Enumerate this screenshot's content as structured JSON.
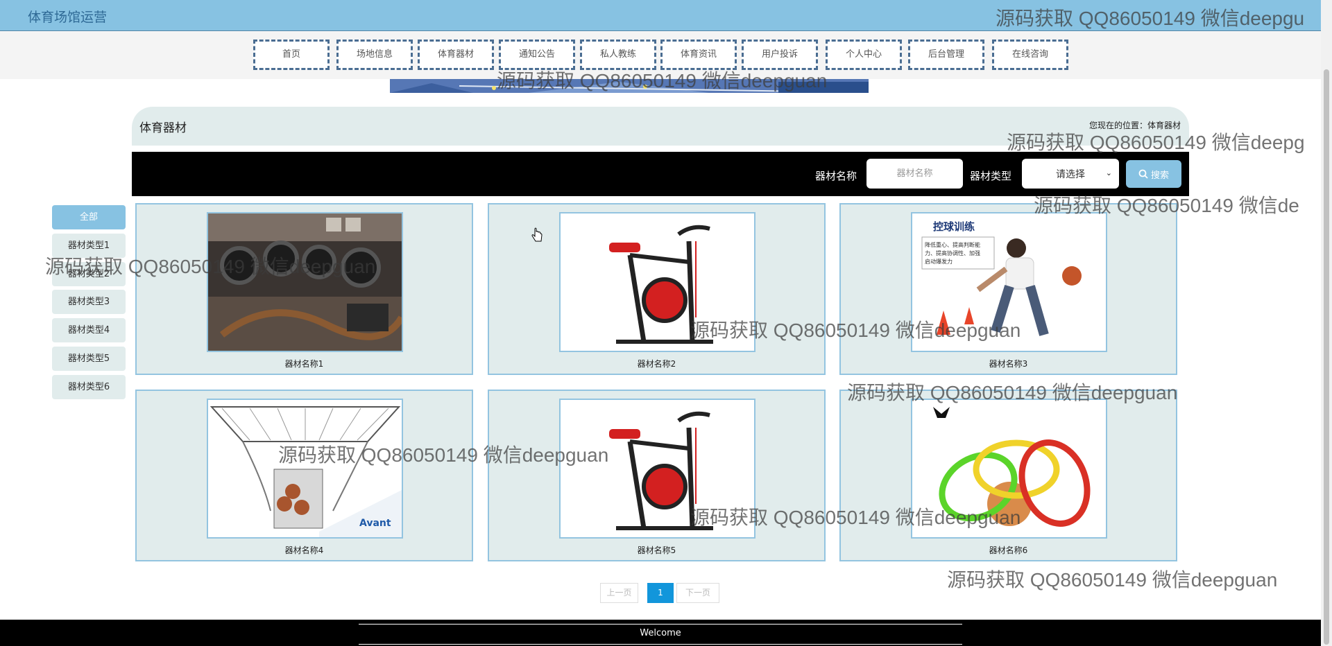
{
  "header": {
    "site_title": "体育场馆运营"
  },
  "nav": {
    "items": [
      {
        "label": "首页"
      },
      {
        "label": "场地信息"
      },
      {
        "label": "体育器材"
      },
      {
        "label": "通知公告"
      },
      {
        "label": "私人教练"
      },
      {
        "label": "体育资讯"
      },
      {
        "label": "用户投诉"
      },
      {
        "label": "个人中心"
      },
      {
        "label": "后台管理"
      },
      {
        "label": "在线咨询"
      }
    ]
  },
  "breadcrumb": {
    "title": "体育器材",
    "location": "您现在的位置：体育器材"
  },
  "search": {
    "name_label": "器材名称",
    "name_placeholder": "器材名称",
    "type_label": "器材类型",
    "type_selected": "请选择",
    "button_label": "搜索"
  },
  "sidebar": {
    "items": [
      {
        "label": "全部"
      },
      {
        "label": "器材类型1"
      },
      {
        "label": "器材类型2"
      },
      {
        "label": "器材类型3"
      },
      {
        "label": "器材类型4"
      },
      {
        "label": "器材类型5"
      },
      {
        "label": "器材类型6"
      }
    ]
  },
  "products": [
    {
      "name": "器材名称1",
      "image": "gym-tires"
    },
    {
      "name": "器材名称2",
      "image": "spin-bike"
    },
    {
      "name": "器材名称3",
      "image": "ball-control-training"
    },
    {
      "name": "器材名称4",
      "image": "basketball-machine"
    },
    {
      "name": "器材名称5",
      "image": "spin-bike"
    },
    {
      "name": "器材名称6",
      "image": "agility-rings"
    }
  ],
  "product_images": {
    "ball-control-training": {
      "heading": "控球训练",
      "text": [
        "降低重心、提高判断能",
        "力、提高协调性、加强",
        "启动爆发力"
      ]
    },
    "basketball-machine": {
      "brand": "Avant"
    }
  },
  "pagination": {
    "prev": "上一页",
    "current": "1",
    "next": "下一页"
  },
  "footer": {
    "text": "Welcome"
  },
  "watermark": {
    "text": "源码获取 QQ86050149 微信deepguan",
    "top_right_text": "源码获取 QQ86050149 微信deepgu",
    "right_text_1": "源码获取 QQ86050149 微信deepg",
    "right_text_2": "源码获取 QQ86050149 微信de"
  },
  "colors": {
    "accent": "#87c2e2",
    "card_bg": "#e1ecec",
    "card_border": "#93c4e0",
    "nav_border": "#4a6d92",
    "page_current": "#1296db"
  }
}
